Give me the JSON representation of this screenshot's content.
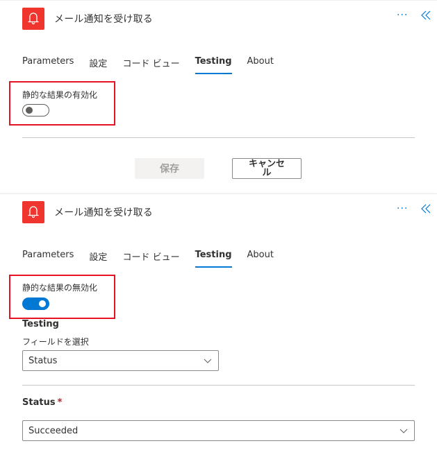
{
  "colors": {
    "accent": "#0078d4",
    "app_icon_bg": "#f0352e",
    "highlight": "#e81123",
    "required": "#a4262c"
  },
  "panels": [
    {
      "header": {
        "title": "メール通知を受け取る",
        "icon": "bell-icon",
        "more_label": "···",
        "collapse_icon": "double-chevron-left-icon"
      },
      "tabs": [
        {
          "label": "Parameters",
          "active": false
        },
        {
          "label": "設定",
          "active": false
        },
        {
          "label": "コード ビュー",
          "active": false
        },
        {
          "label": "Testing",
          "active": true
        },
        {
          "label": "About",
          "active": false
        }
      ],
      "toggle": {
        "label": "静的な結果の有効化",
        "on": false
      },
      "buttons": {
        "save_label": "保存",
        "save_disabled": true,
        "cancel_label": "キャンセル"
      }
    },
    {
      "header": {
        "title": "メール通知を受け取る",
        "icon": "bell-icon",
        "more_label": "···",
        "collapse_icon": "double-chevron-left-icon"
      },
      "tabs": [
        {
          "label": "Parameters",
          "active": false
        },
        {
          "label": "設定",
          "active": false
        },
        {
          "label": "コード ビュー",
          "active": false
        },
        {
          "label": "Testing",
          "active": true
        },
        {
          "label": "About",
          "active": false
        }
      ],
      "toggle": {
        "label": "静的な結果の無効化",
        "on": true
      },
      "testing": {
        "section_title": "Testing",
        "field_select_label": "フィールドを選択",
        "field_select_value": "Status",
        "status_label": "Status",
        "status_required_mark": "*",
        "status_value": "Succeeded"
      }
    }
  ]
}
